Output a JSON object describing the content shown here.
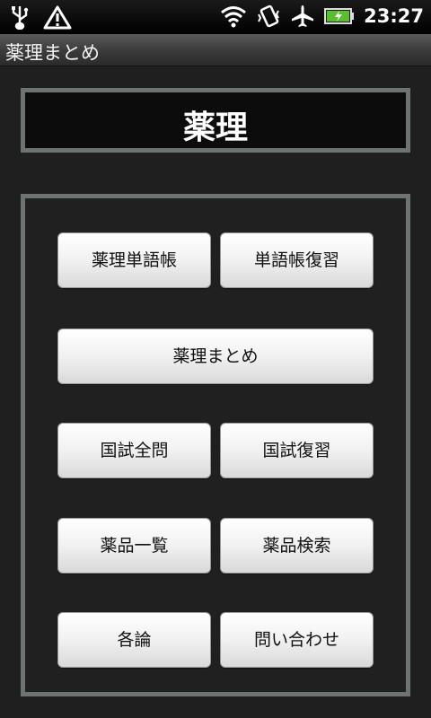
{
  "status_bar": {
    "time": "23:27",
    "icons": [
      "usb-icon",
      "warning-icon",
      "wifi-icon",
      "vibrate-icon",
      "airplane-mode-icon",
      "battery-charging-icon"
    ]
  },
  "app": {
    "title": "薬理まとめ"
  },
  "header": {
    "title": "薬理"
  },
  "menu": {
    "vocab": "薬理単語帳",
    "vocab_review": "単語帳復習",
    "summary": "薬理まとめ",
    "exam_all": "国試全問",
    "exam_review": "国試復習",
    "drug_list": "薬品一覧",
    "drug_search": "薬品検索",
    "each_topic": "各論",
    "contact": "問い合わせ"
  },
  "colors": {
    "background": "#1f1f1f",
    "frame_border": "#6b7470",
    "button_face": "#f1f1f1"
  }
}
